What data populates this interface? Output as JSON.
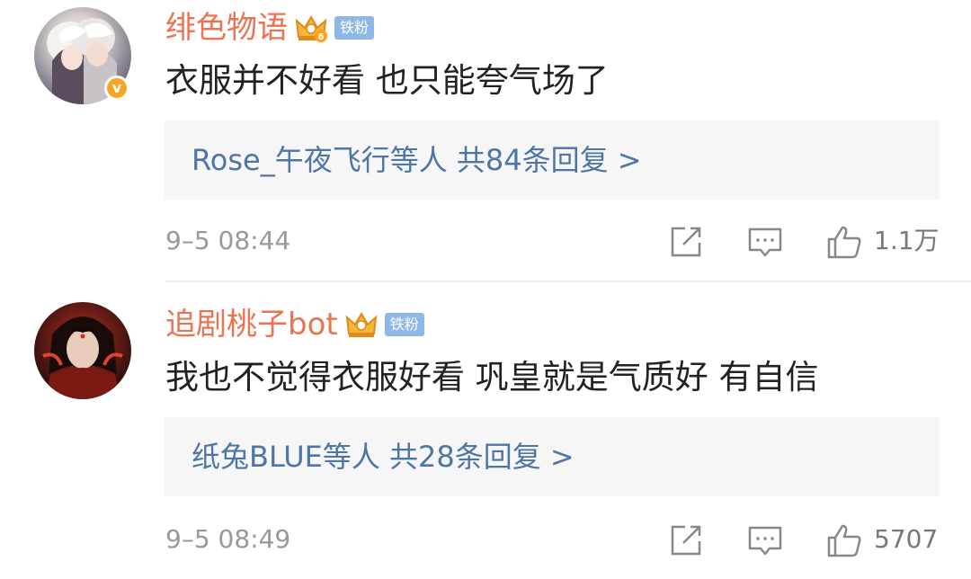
{
  "colors": {
    "username": "#eb7350",
    "reply_link": "#4c76a5",
    "fan_badge_bg": "#8fb8e6",
    "verified_badge": "#f5a623",
    "meta_text": "#999999",
    "comment_text": "#222222",
    "reply_bg": "#f6f6f6"
  },
  "comments": [
    {
      "username": "绯色物语",
      "badge": "铁粉",
      "verified_mark": "v",
      "avatar_icon": "anime-avatar-icon",
      "crown_icon": "vip-crown-icon",
      "text": "衣服并不好看 也只能夸气场了",
      "replies_summary": "Rose_午夜飞行等人  共84条回复 >",
      "timestamp": "9–5 08:44",
      "like_count": "1.1万",
      "actions": [
        "share-icon",
        "comment-icon",
        "like-icon"
      ]
    },
    {
      "username": "追剧桃子bot",
      "badge": "铁粉",
      "avatar_icon": "anime-avatar-icon",
      "crown_icon": "vip-crown-icon",
      "text": "我也不觉得衣服好看 巩皇就是气质好 有自信",
      "replies_summary": "纸兔BLUE等人  共28条回复 >",
      "timestamp": "9–5 08:49",
      "like_count": "5707",
      "actions": [
        "share-icon",
        "comment-icon",
        "like-icon"
      ]
    }
  ]
}
